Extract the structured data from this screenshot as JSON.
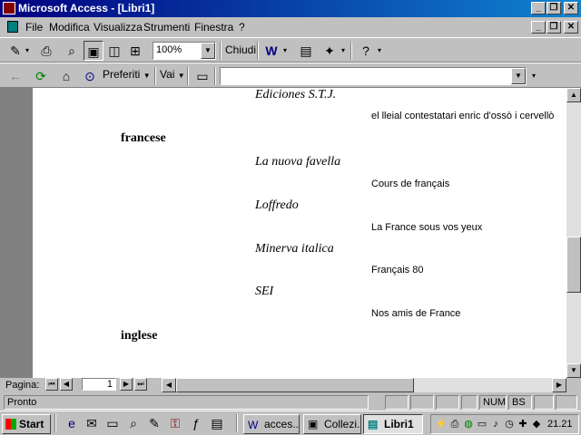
{
  "window": {
    "title": "Microsoft Access - [Libri1]",
    "min_label": "_",
    "restore_label": "❐",
    "close_label": "✕"
  },
  "menu": {
    "items": [
      "File",
      "Modifica",
      "Visualizza",
      "Strumenti",
      "Finestra",
      "?"
    ]
  },
  "toolbar1": {
    "zoom_value": "100%",
    "close_label": "Chiudi"
  },
  "toolbar2": {
    "favorites_label": "Preferiti",
    "go_label": "Vai",
    "address_value": ""
  },
  "report": {
    "rows": [
      {
        "kind": "pub",
        "text": "Ediciones S.T.J."
      },
      {
        "kind": "book",
        "text": "el lleial contestatari enric d'ossò i cervellò"
      },
      {
        "kind": "lang",
        "text": "francese"
      },
      {
        "kind": "pub",
        "text": "La nuova favella"
      },
      {
        "kind": "book",
        "text": "Cours de français"
      },
      {
        "kind": "pub",
        "text": "Loffredo"
      },
      {
        "kind": "book",
        "text": "La France sous vos yeux"
      },
      {
        "kind": "pub",
        "text": "Minerva italica"
      },
      {
        "kind": "book",
        "text": "Français 80"
      },
      {
        "kind": "pub",
        "text": "SEI"
      },
      {
        "kind": "book",
        "text": "Nos amis de France"
      },
      {
        "kind": "lang",
        "text": "inglese"
      }
    ]
  },
  "navigation": {
    "label": "Pagina:",
    "page_number": "1"
  },
  "status": {
    "text": "Pronto",
    "num": "NUM",
    "bs": "BS"
  },
  "taskbar": {
    "start_label": "Start",
    "tasks": [
      "acces...",
      "Collezi...",
      "Libri1"
    ],
    "active_task": "Libri1",
    "clock": "21.21"
  },
  "colors": {
    "title_start": "#000080",
    "title_end": "#1084d0",
    "chrome": "#c0c0c0",
    "document_bg": "#ffffff"
  }
}
